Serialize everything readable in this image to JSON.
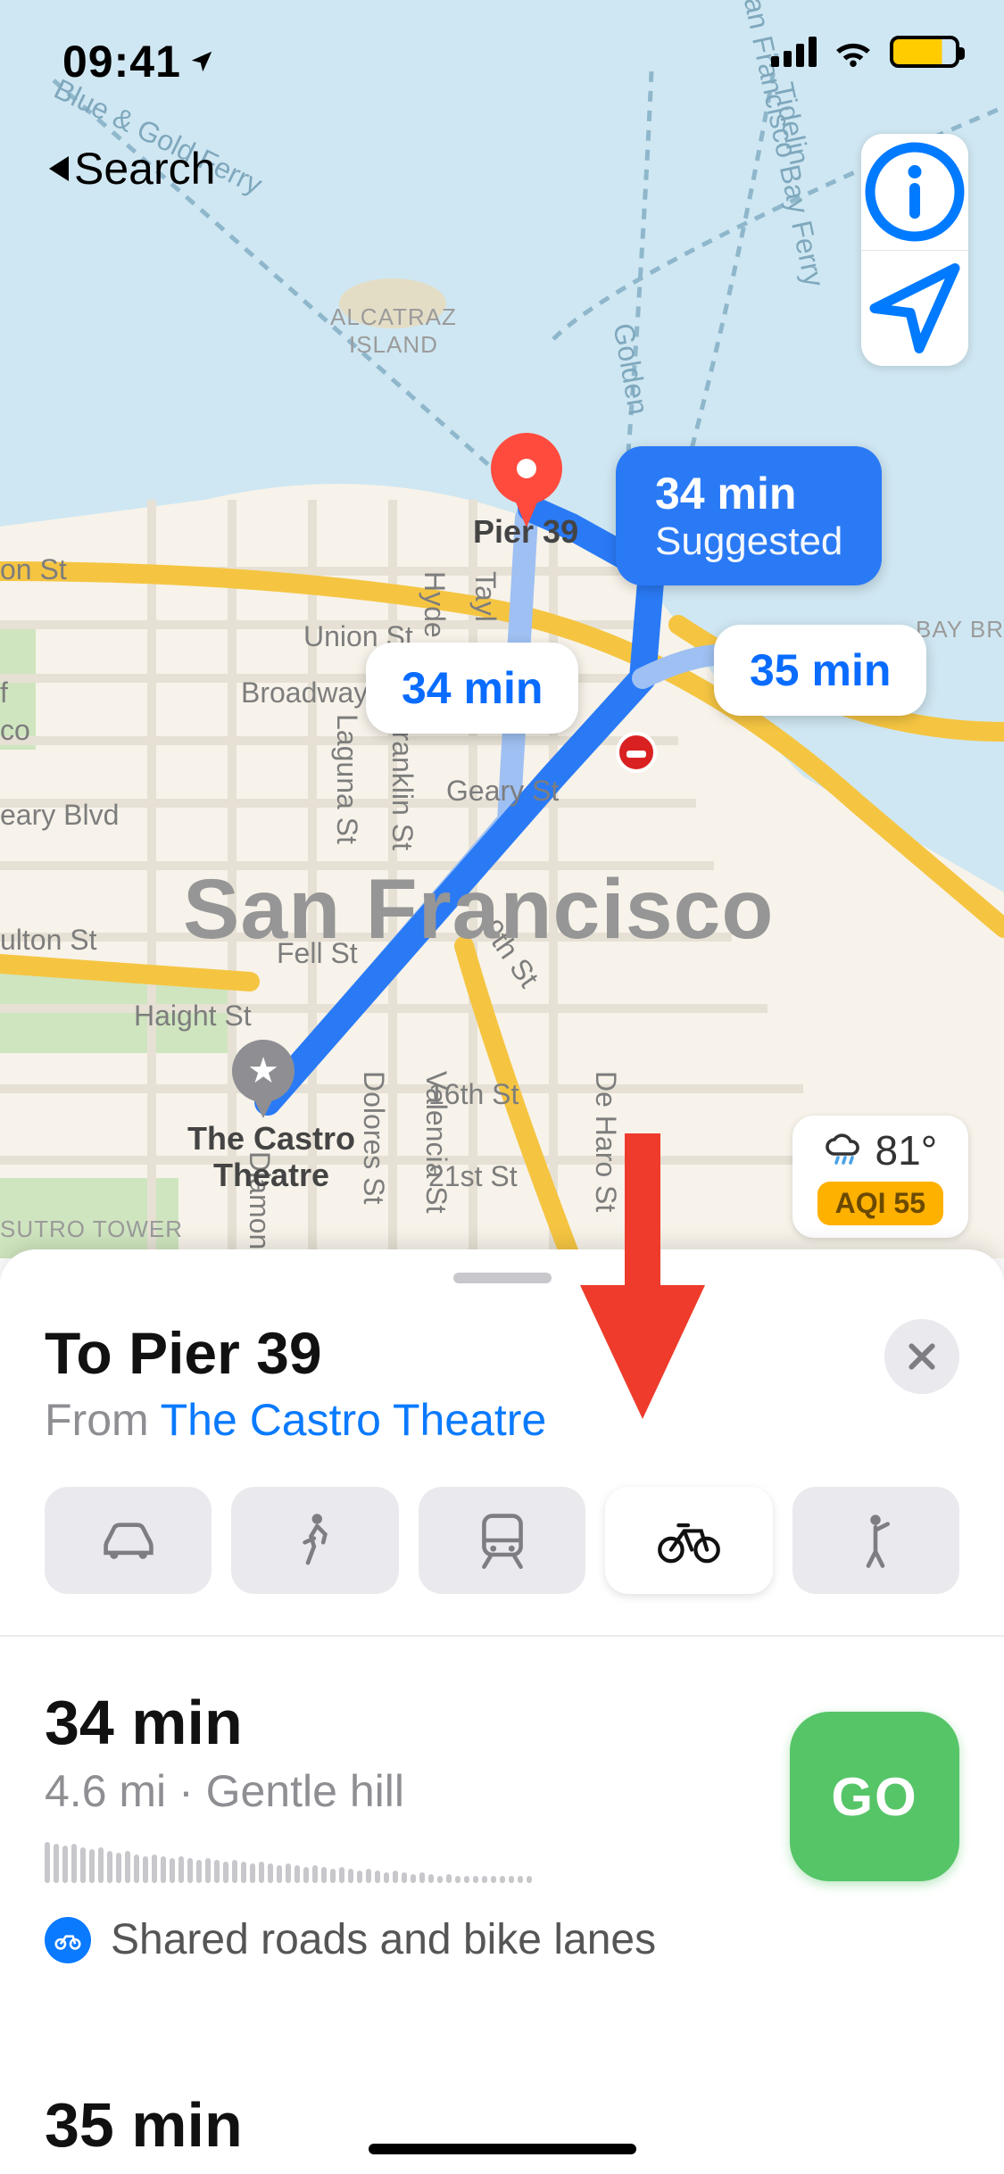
{
  "status": {
    "time": "09:41",
    "back_label": "Search"
  },
  "map_controls": {
    "info_icon": "info-circle",
    "locate_icon": "location-arrow"
  },
  "weather": {
    "temp": "81°",
    "aqi": "AQI 55"
  },
  "map": {
    "city": "San Francisco",
    "destination_marker": "Pier 39",
    "origin_marker": "The Castro\nTheatre",
    "poi": {
      "alcatraz": "ALCATRAZ\nISLAND",
      "sutro": "SUTRO TOWER",
      "bay_br": "BAY BR"
    },
    "ferries": {
      "blue_gold": "Blue & Gold Ferry",
      "sf_bay": "San Francisco Bay Ferry",
      "golden": "Golden",
      "tidelin": "Tidelin"
    },
    "streets": {
      "on_st": "on St",
      "union": "Union St",
      "broadway": "Broadway St",
      "geary": "Geary St",
      "eary_blvd": "eary Blvd",
      "fulton": "ulton St",
      "fell": "Fell St",
      "haight": "Haight St",
      "sixteenth": "16th St",
      "twentyfirst": "21st St",
      "hyde": "Hyde St",
      "tayl": "Tayl",
      "laguna": "Laguna St",
      "franklin": "Franklin St",
      "ninth": "9th St",
      "valencia": "Valencia St",
      "dolores": "Dolores St",
      "de_haro": "De Haro St",
      "diamon": "Diamon",
      "f": "f",
      "co": "co"
    },
    "route_bubbles": {
      "primary": {
        "time": "34 min",
        "sub": "Suggested"
      },
      "alt1": {
        "time": "34 min"
      },
      "alt2": {
        "time": "35 min"
      }
    }
  },
  "sheet": {
    "title": "To Pier 39",
    "from_label": "From ",
    "from_link": "The Castro Theatre",
    "modes": [
      "drive",
      "walk",
      "transit",
      "cycle",
      "rideshare"
    ],
    "selected_mode": "cycle",
    "route": {
      "time": "34 min",
      "distance": "4.6 mi",
      "terrain": "Gentle hill",
      "shared_label": "Shared roads and bike lanes",
      "go": "GO"
    },
    "next_route_preview": "35 min"
  }
}
